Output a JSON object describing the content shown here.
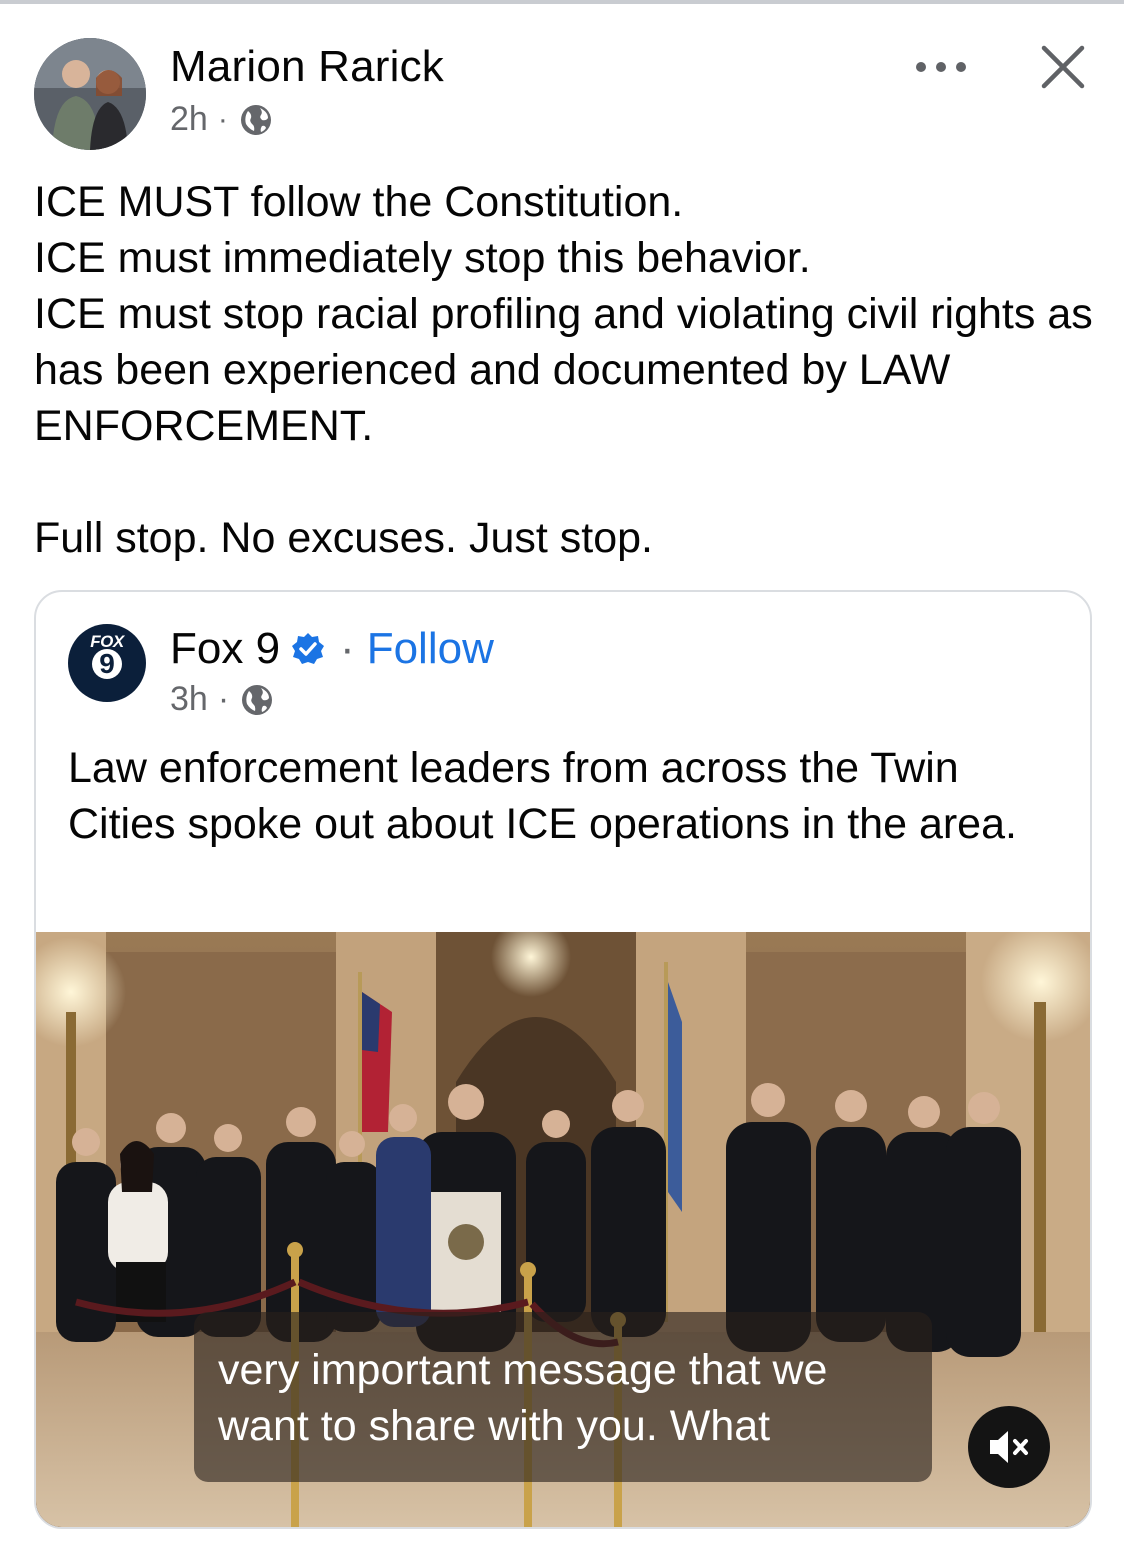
{
  "post": {
    "author_name": "Marion Rarick",
    "time": "2h",
    "separator": "·",
    "lines": [
      "ICE MUST follow the Constitution.",
      "ICE must immediately stop this behavior.",
      "ICE must stop racial profiling and violating civil rights as has been experienced and documented by LAW ENFORCEMENT."
    ],
    "closing": "Full stop. No excuses. Just stop.",
    "audience_icon": "globe-icon"
  },
  "shared": {
    "logo_text_top": "FOX",
    "logo_text_number": "9",
    "source_name": "Fox 9",
    "separator": "·",
    "follow_label": "Follow",
    "time": "3h",
    "text": "Law enforcement leaders from across the Twin Cities spoke out about ICE operations in the area.",
    "video": {
      "caption_line1": "very important message that we",
      "caption_line2": "want to share with you. What",
      "muted": true
    }
  },
  "icons": {
    "more": "more-options-icon",
    "close": "close-icon",
    "verified": "verified-badge-icon",
    "mute": "speaker-muted-icon"
  },
  "colors": {
    "link": "#1b74e4",
    "meta": "#65676b",
    "text": "#050505"
  }
}
